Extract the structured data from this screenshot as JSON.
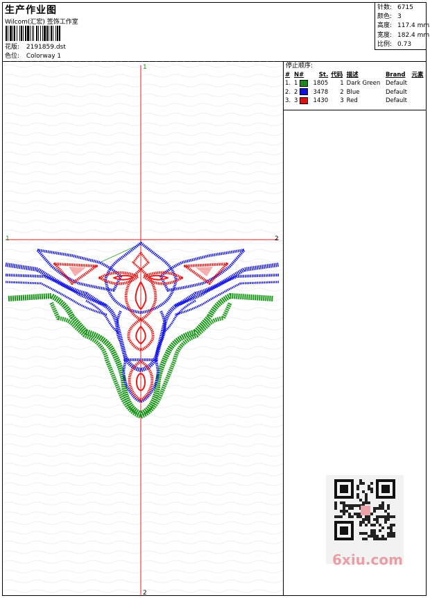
{
  "header": {
    "title": "生产作业图",
    "company": "Wilcom(汇宏) 签饰工作室",
    "design_label": "花版:",
    "design_value": "2191859.dst",
    "color_label": "色位:",
    "color_value": "Colorway 1"
  },
  "stats": [
    {
      "label": "针数:",
      "value": "6715"
    },
    {
      "label": "颜色:",
      "value": "3"
    },
    {
      "label": "高度:",
      "value": "117.4 mm"
    },
    {
      "label": "宽度:",
      "value": "182.4 mm"
    },
    {
      "label": "比例:",
      "value": "0.73"
    }
  ],
  "axis": {
    "top": "1",
    "bottom": "2",
    "left": "1",
    "right": "2"
  },
  "stop_sequence": {
    "title": "停止顺序:",
    "headers": [
      "#",
      "N#",
      "St.",
      "代码",
      "描述",
      "Brand",
      "元素"
    ],
    "rows": [
      {
        "num": "1.",
        "n": "1",
        "color": "#1a8a1a",
        "st": "1805",
        "code": "1",
        "desc": "Dark Green",
        "brand": "Default"
      },
      {
        "num": "2.",
        "n": "2",
        "color": "#1010e0",
        "st": "3478",
        "code": "2",
        "desc": "Blue",
        "brand": "Default"
      },
      {
        "num": "3.",
        "n": "3",
        "color": "#e01010",
        "st": "1430",
        "code": "3",
        "desc": "Red",
        "brand": "Default"
      }
    ]
  },
  "watermark": {
    "text": "6xiu.com"
  },
  "colors": {
    "green": "#159415",
    "blue": "#1a1ae6",
    "red": "#e61a1a",
    "guide": "#e02020"
  }
}
